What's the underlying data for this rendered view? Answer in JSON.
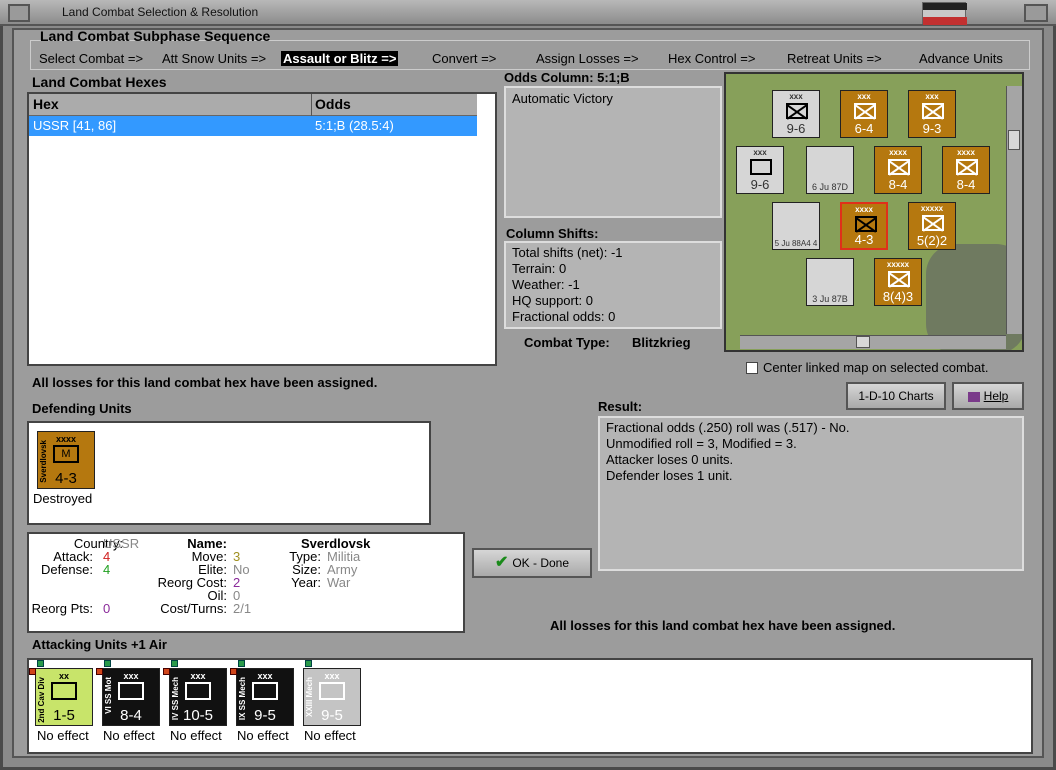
{
  "window": {
    "title": "Land Combat Selection & Resolution"
  },
  "subphase": {
    "title": "Land Combat Subphase Sequence",
    "steps": [
      "Select Combat =>",
      "Att Snow Units =>",
      "Assault or Blitz =>",
      "Convert =>",
      "Assign Losses =>",
      "Hex Control =>",
      "Retreat Units =>",
      "Advance Units"
    ],
    "active_index": 2
  },
  "hexes": {
    "title": "Land Combat Hexes",
    "columns": [
      "Hex",
      "Odds"
    ],
    "rows": [
      {
        "hex": "USSR [41, 86]",
        "odds": "5:1;B (28.5:4)"
      }
    ]
  },
  "odds": {
    "title": "Odds Column: 5:1;B",
    "text": "Automatic Victory",
    "shifts_title": "Column Shifts:",
    "shifts": [
      "Total shifts (net): -1",
      "Terrain: 0",
      "Weather: -1",
      "HQ support: 0",
      "Fractional odds: 0"
    ],
    "combat_type_label": "Combat Type:",
    "combat_type": "Blitzkrieg"
  },
  "map": {
    "units": [
      {
        "size": "xxx",
        "value": "9-6",
        "style": "grey"
      },
      {
        "size": "xxx",
        "value": "6-4",
        "style": "brown"
      },
      {
        "size": "xxx",
        "value": "9-3",
        "style": "brown"
      },
      {
        "size": "xxx",
        "value": "9-6",
        "style": "grey"
      },
      {
        "size": "",
        "value": "6 Ju 87D",
        "style": "grey"
      },
      {
        "size": "xxxx",
        "value": "8-4",
        "style": "brown"
      },
      {
        "size": "xxxx",
        "value": "8-4",
        "style": "brown"
      },
      {
        "size": "",
        "value": "5 Ju 88A4 4",
        "style": "grey"
      },
      {
        "size": "xxxx",
        "value": "4-3",
        "style": "brown"
      },
      {
        "size": "xxxxx",
        "value": "5(2)2",
        "style": "brown"
      },
      {
        "size": "",
        "value": "3 Ju 87B",
        "style": "grey"
      },
      {
        "size": "xxxxx",
        "value": "8(4)3",
        "style": "brown"
      }
    ],
    "center_label": "Center linked map on selected combat."
  },
  "buttons": {
    "charts": "1-D-10 Charts",
    "help": "Help",
    "ok": "OK - Done"
  },
  "losses_msg": "All losses for this land combat hex have been assigned.",
  "defending": {
    "title": "Defending Units",
    "units": [
      {
        "size": "xxxx",
        "name": "Sverdlovsk",
        "symbol": "M",
        "value": "4-3",
        "status": "Destroyed"
      }
    ]
  },
  "info": {
    "country_label": "Country:",
    "country": "USSR",
    "attack_label": "Attack:",
    "attack": "4",
    "defense_label": "Defense:",
    "defense": "4",
    "reorg_pts_label": "Reorg Pts:",
    "reorg_pts": "0",
    "name_label": "Name:",
    "name": "Sverdlovsk",
    "move_label": "Move:",
    "move": "3",
    "type_label": "Type:",
    "type": "Militia",
    "elite_label": "Elite:",
    "elite": "No",
    "size_label": "Size:",
    "size": "Army",
    "reorg_cost_label": "Reorg Cost:",
    "reorg_cost": "2",
    "year_label": "Year:",
    "year": "War",
    "oil_label": "Oil:",
    "oil": "0",
    "cost_turns_label": "Cost/Turns:",
    "cost_turns": "2/1"
  },
  "result": {
    "title": "Result:",
    "lines": [
      "Fractional odds (.250) roll was (.517)  - No.",
      "Unmodified roll = 3, Modified = 3.",
      "Attacker loses 0 units.",
      "Defender loses 1 unit."
    ]
  },
  "attacking": {
    "title": "Attacking Units +1 Air",
    "units": [
      {
        "size": "xx",
        "name": "2nd Cav Div",
        "value": "1-5",
        "status": "No effect",
        "style": "green"
      },
      {
        "size": "xxx",
        "name": "VI SS Mot",
        "value": "8-4",
        "status": "No effect",
        "style": "black"
      },
      {
        "size": "xxx",
        "name": "IV SS Mech",
        "value": "10-5",
        "status": "No effect",
        "style": "black"
      },
      {
        "size": "xxx",
        "name": "IX SS Mech",
        "value": "9-5",
        "status": "No effect",
        "style": "black"
      },
      {
        "size": "xxx",
        "name": "XXIII Mech",
        "value": "9-5",
        "status": "No effect",
        "style": "lgrey"
      }
    ]
  },
  "colors": {
    "selection": "#3399ff",
    "soviet": "#b5780f",
    "panel": "#9c9c9c"
  }
}
